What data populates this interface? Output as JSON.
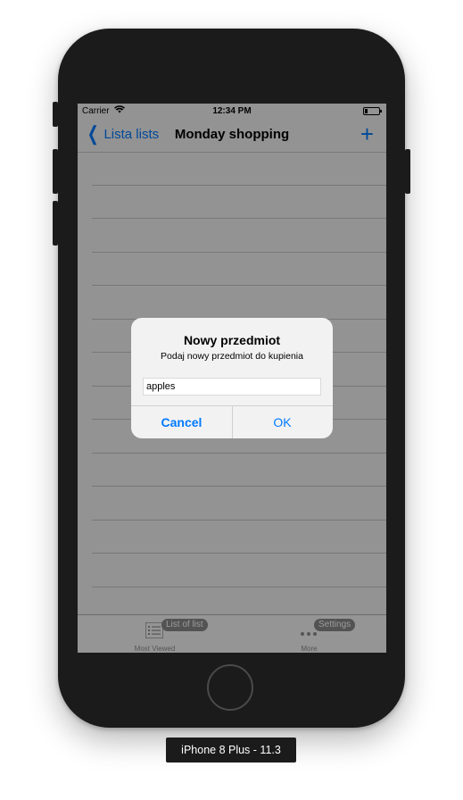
{
  "status": {
    "carrier": "Carrier",
    "time": "12:34 PM"
  },
  "nav": {
    "back_label": "Lista lists",
    "title": "Monday shopping",
    "add_label": "+"
  },
  "table": {
    "row_count": 14
  },
  "tabbar": {
    "tabs": [
      {
        "label": "Most Viewed",
        "badge": "List of list",
        "icon": "list-icon"
      },
      {
        "label": "More",
        "badge": "Settings",
        "icon": "more-icon"
      }
    ]
  },
  "alert": {
    "title": "Nowy przedmiot",
    "message": "Podaj nowy przedmiot do kupienia",
    "input_value": "apples",
    "cancel_label": "Cancel",
    "ok_label": "OK"
  },
  "device": {
    "label": "iPhone 8 Plus - 11.3"
  },
  "colors": {
    "accent": "#007aff",
    "phone_body": "#1b1b1b"
  }
}
